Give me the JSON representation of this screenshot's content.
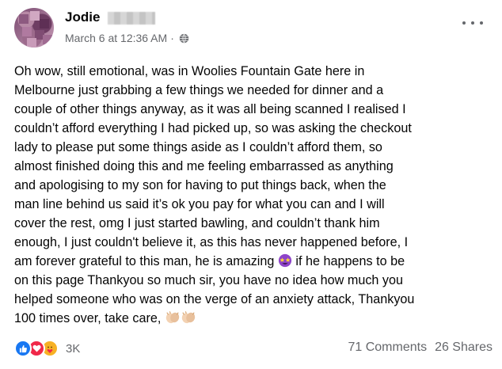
{
  "post": {
    "author": "Jodie",
    "timestamp": "March 6 at 12:36 AM",
    "separator": "·",
    "privacy_icon": "globe-icon",
    "more_icon": "more-horizontal-icon",
    "text_lines": [
      "Oh wow, still emotional, was in Woolies Fountain Gate here in",
      "Melbourne just grabbing a few things we needed for dinner and a",
      "couple of other things anyway, as it was all being scanned I realised I",
      "couldn’t afford everything I had picked up, so was asking the checkout",
      "lady to please put some things aside as I couldn’t afford them, so",
      "almost finished doing this and me feeling embarrassed as anything",
      "and apologising to my son for having to put things back, when the",
      "man line behind us said it’s ok you pay for what you can and I will",
      "cover the rest, omg I just started bawling, and couldn’t thank him",
      "enough, I just couldn't believe it, as this has never happened before, I",
      "am forever grateful to this man, he is amazing",
      "on this page Thankyou so much sir, you have no idea how much you",
      "helped someone who was on the verge of an anxiety attack, Thankyou",
      "100 times over, take care,"
    ],
    "line11_suffix": " if he happens to be",
    "emojis": [
      "star-struck-emoji",
      "clapping-hands-emoji"
    ]
  },
  "footer": {
    "reaction_icons": [
      "like-icon",
      "love-icon",
      "care-icon"
    ],
    "reaction_count": "3K",
    "comments": "71 Comments",
    "shares": "26 Shares"
  },
  "colors": {
    "text": "#050505",
    "secondary": "#65676b",
    "like_blue": "#1877f2",
    "love_red": "#f02849",
    "care_yellow": "#f7b125"
  }
}
